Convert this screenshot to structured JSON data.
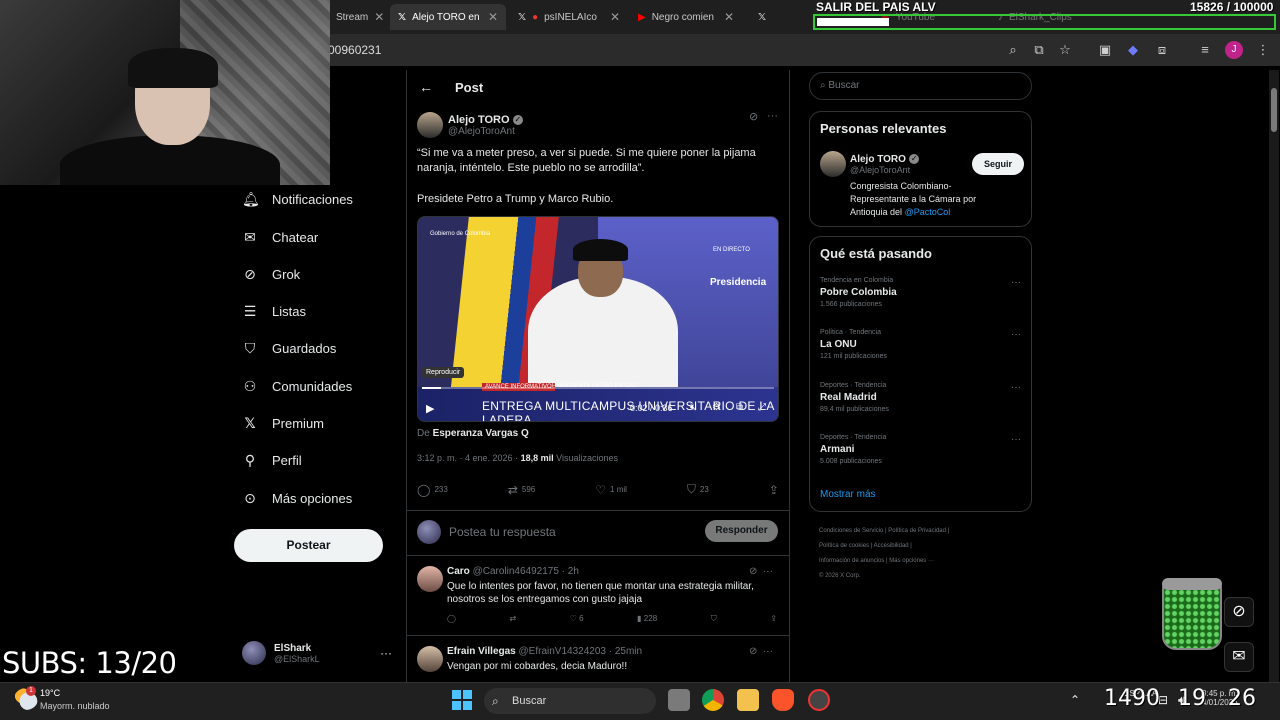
{
  "browser": {
    "tabs": [
      {
        "label": "Stream",
        "icon": "stream-tab-icon",
        "active": false
      },
      {
        "label": "Alejo TORO en",
        "icon": "x-logo-icon",
        "active": true
      },
      {
        "label": "psINELAIco",
        "icon": "x-logo-icon",
        "active": false
      },
      {
        "label": "Negro comien",
        "icon": "youtube-icon",
        "active": false
      },
      {
        "label": "YouTube",
        "icon": "youtube-icon",
        "active": false
      },
      {
        "label": "ElShark_Clips",
        "icon": "tiktok-icon",
        "active": false
      }
    ],
    "url_partial": "00960231"
  },
  "overlay": {
    "goal_title": "SALIR DEL PAIS ALV",
    "goal_count": "15826",
    "goal_target": "/ 100000",
    "goal_progress": 0.158,
    "subs": "SUBS: 13/20",
    "timer": {
      "hours": "1490",
      "minutes": "19",
      "seconds": "26"
    }
  },
  "nav": {
    "items": [
      {
        "label": "Notificaciones",
        "icon": "bell-icon"
      },
      {
        "label": "Chatear",
        "icon": "mail-icon"
      },
      {
        "label": "Grok",
        "icon": "grok-icon"
      },
      {
        "label": "Listas",
        "icon": "list-icon"
      },
      {
        "label": "Guardados",
        "icon": "bookmark-icon"
      },
      {
        "label": "Comunidades",
        "icon": "people-icon"
      },
      {
        "label": "Premium",
        "icon": "x-logo-icon"
      },
      {
        "label": "Perfil",
        "icon": "person-icon"
      },
      {
        "label": "Más opciones",
        "icon": "more-circle-icon"
      }
    ],
    "post_button": "Postear",
    "account": {
      "name": "ElShark",
      "handle": "@ElSharkL"
    }
  },
  "post": {
    "header": "Post",
    "author": {
      "name": "Alejo TORO",
      "handle": "@AlejoToroAnt"
    },
    "text1": "“Si me va a meter preso, a ver si puede. Si me quiere poner la pijama naranja, inténtelo. Este pueblo no se arrodilla”.",
    "text2": "Presidete Petro a Trump y Marco Rubio.",
    "video": {
      "caption": "ENTREGA MULTICAMPUS UNIVERSITARIO DE LA LADERA",
      "tag_left": "AVANCE INFORMATIVO",
      "tag_right": "PRESIDENTE PETRO EN CALI",
      "brand": "Presidencia",
      "live": "EN DIRECTO",
      "govt": "Gobierno de Colombia",
      "play_tooltip": "Reproducir",
      "time": "0:02 / 0:36",
      "progress": 0.055
    },
    "from_prefix": "De",
    "from_name": "Esperanza Vargas Q",
    "timestamp": "3:12 p. m. · 4 ene. 2026 ·",
    "views_count": "18,8 mil",
    "views_label": "Visualizaciones",
    "stats": {
      "replies": "233",
      "reposts": "596",
      "likes": "1 mil",
      "bookmarks": "23"
    },
    "reply_placeholder": "Postea tu respuesta",
    "reply_button": "Responder"
  },
  "comments": [
    {
      "name": "Caro",
      "handle": "@Carolin46492175 · 2h",
      "text": "Que lo intentes por favor, no tienen que montar una estrategia militar, nosotros se los entregamos con gusto jajaja",
      "reposts": "",
      "likes": "6",
      "views": "228"
    },
    {
      "name": "Efrain Villegas",
      "handle": "@EfrainV14324203 · 25min",
      "text": "Vengan por mi cobardes, decia Maduro!!",
      "reposts": "",
      "likes": "",
      "views": ""
    }
  ],
  "sidebar": {
    "search_placeholder": "Buscar",
    "relevant_title": "Personas relevantes",
    "relevant": {
      "name": "Alejo TORO",
      "handle": "@AlejoToroAnt",
      "bio": "Congresista Colombiano- Representante a la Cámara por Antioquia del",
      "bio_link": "@PactoCol",
      "follow": "Seguir"
    },
    "trending_title": "Qué está pasando",
    "trends": [
      {
        "category": "Tendencia en Colombia",
        "name": "Pobre Colombia",
        "count": "1.566 publicaciones"
      },
      {
        "category": "Política · Tendencia",
        "name": "La ONU",
        "count": "121 mil publicaciones"
      },
      {
        "category": "Deportes · Tendencia",
        "name": "Real Madrid",
        "count": "89,4 mil publicaciones"
      },
      {
        "category": "Deportes · Tendencia",
        "name": "Armani",
        "count": "5.008 publicaciones"
      }
    ],
    "show_more": "Mostrar más",
    "footer": [
      "Condiciones de Servicio",
      "Política de Privacidad",
      "Política de cookies",
      "Accesibilidad",
      "Información de anuncios",
      "Más opciones ···",
      "© 2026 X Corp."
    ]
  },
  "taskbar": {
    "weather_temp": "19°C",
    "weather_desc": "Mayorm. nublado",
    "weather_badge": "1",
    "search": "Buscar",
    "time": "8:45 p. m.",
    "date": "4/01/2026",
    "lang": "ESP LAA"
  },
  "colors": {
    "accent": "#1d9bf0",
    "goal_border": "#37c837",
    "background": "#000000"
  }
}
